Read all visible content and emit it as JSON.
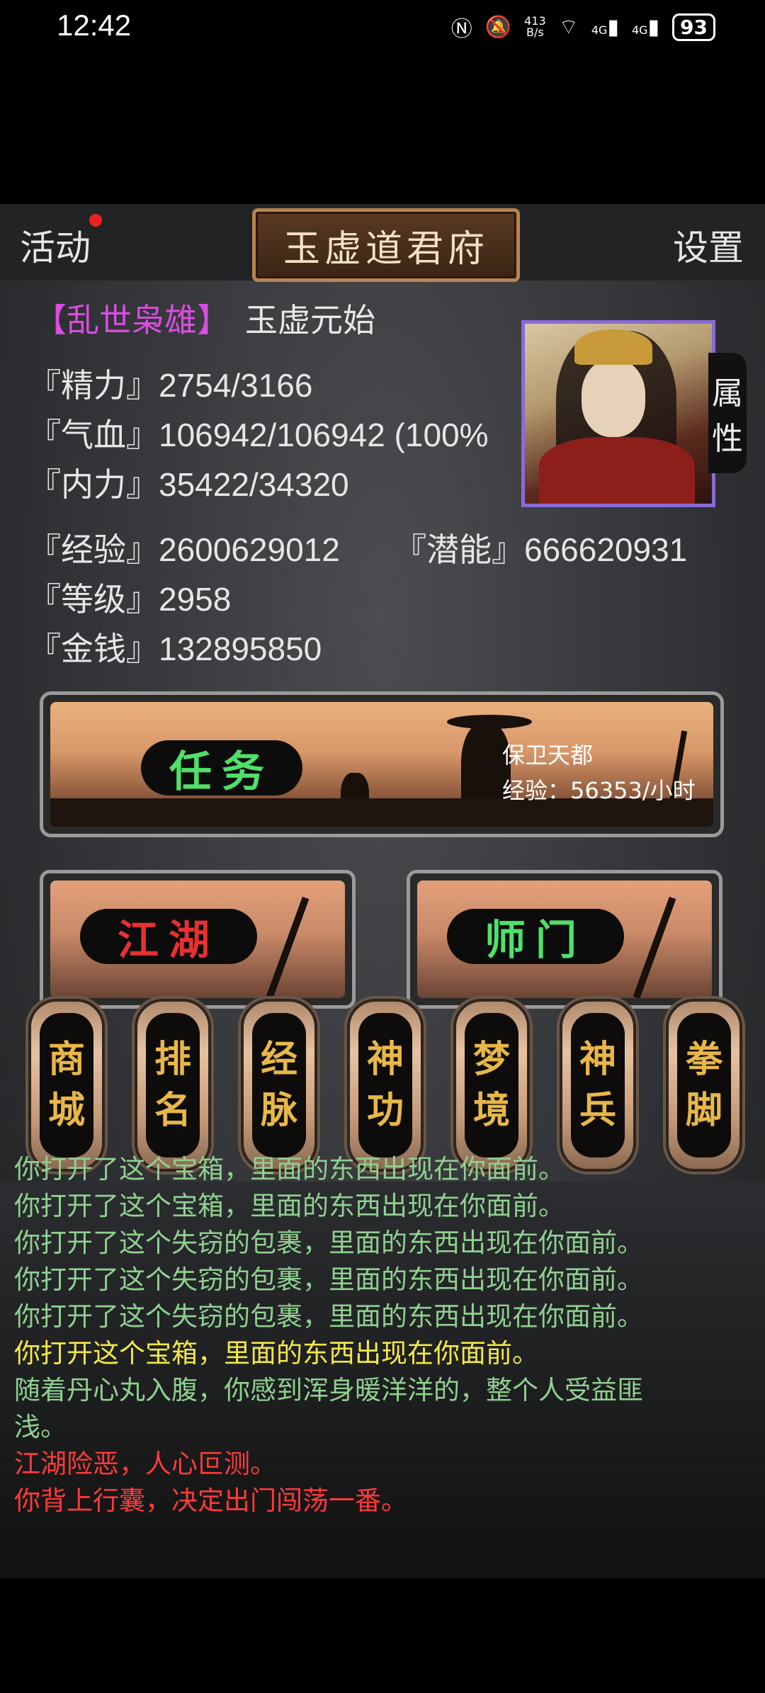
{
  "status_bar": {
    "time": "12:42",
    "net_speed": "413\nB/s",
    "signal1": "4G",
    "signal2": "4G",
    "battery": "93"
  },
  "header": {
    "activity_label": "活动",
    "title": "玉虚道君府",
    "settings_label": "设置"
  },
  "character": {
    "title": "【乱世枭雄】",
    "name": "玉虚元始",
    "attr_tab_label": [
      "属",
      "性"
    ],
    "stats": {
      "energy": "『精力』2754/3166",
      "hp": "『气血』106942/106942 (100%",
      "mp": "『内力』35422/34320",
      "exp": "『经验』2600629012",
      "potential": "『潜能』666620931",
      "level": "『等级』2958",
      "money": "『金钱』132895850"
    }
  },
  "quest": {
    "label": "任务",
    "name": "保卫天都",
    "exp_rate": "经验：56353/小时"
  },
  "sub_buttons": {
    "jianghu": "江湖",
    "shimen": "师门"
  },
  "menu": [
    {
      "top": "商",
      "bottom": "城"
    },
    {
      "top": "排",
      "bottom": "名"
    },
    {
      "top": "经",
      "bottom": "脉"
    },
    {
      "top": "神",
      "bottom": "功"
    },
    {
      "top": "梦",
      "bottom": "境"
    },
    {
      "top": "神",
      "bottom": "兵"
    },
    {
      "top": "拳",
      "bottom": "脚"
    }
  ],
  "log": [
    {
      "text": "你打开了这个宝箱，里面的东西出现在你面前。",
      "color": "#8fd08f"
    },
    {
      "text": "你打开了这个宝箱，里面的东西出现在你面前。",
      "color": "#8fd08f"
    },
    {
      "text": "你打开了这个失窃的包裹，里面的东西出现在你面前。",
      "color": "#8fd08f"
    },
    {
      "text": "你打开了这个失窃的包裹，里面的东西出现在你面前。",
      "color": "#8fd08f"
    },
    {
      "text": "你打开了这个失窃的包裹，里面的东西出现在你面前。",
      "color": "#8fd08f"
    },
    {
      "text": "你打开这个宝箱，里面的东西出现在你面前。",
      "color": "#f2e84a"
    },
    {
      "text": "随着丹心丸入腹，你感到浑身暖洋洋的，整个人受益匪",
      "color": "#8fd08f"
    },
    {
      "text": "浅。",
      "color": "#8fd08f"
    },
    {
      "text": "江湖险恶，人心叵测。",
      "color": "#ff3a3a"
    },
    {
      "text": "你背上行囊，决定出门闯荡一番。",
      "color": "#ff3a3a"
    }
  ],
  "colors": {
    "jianghu_text": "#e83030",
    "shimen_text": "#4fe06a",
    "menu_text": "#e8b74a",
    "title_purple": "#d94de0"
  }
}
